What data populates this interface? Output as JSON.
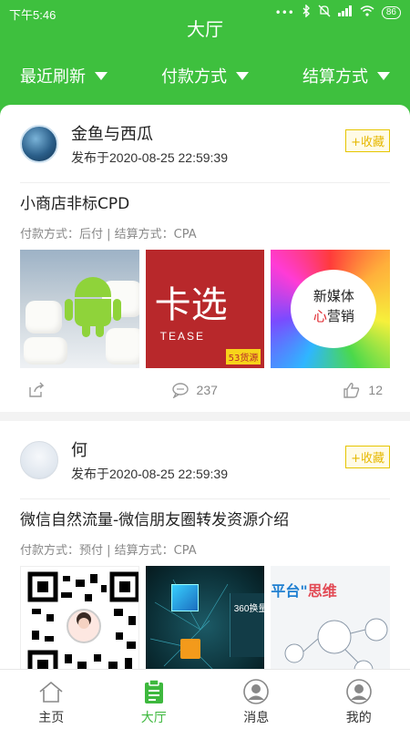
{
  "status_bar": {
    "time": "下午5:46",
    "battery": "86"
  },
  "header": {
    "title": "大厅"
  },
  "filters": [
    {
      "label": "最近刷新"
    },
    {
      "label": "付款方式"
    },
    {
      "label": "结算方式"
    }
  ],
  "posts": [
    {
      "user": "金鱼与西瓜",
      "date": "发布于2020-08-25 22:59:39",
      "favorite_label": "+收藏",
      "title": "小商店非标CPD",
      "meta": "付款方式：后付 | 结算方式：CPA",
      "thumb_texts": {
        "red_big": "卡选",
        "red_tease": "TEASE",
        "red_badge": "53货源",
        "media_line1": "新媒体",
        "media_line2_red": "心",
        "media_line2": "营销"
      },
      "stats": {
        "comments": "237",
        "likes": "12"
      }
    },
    {
      "user": "何",
      "date": "发布于2020-08-25 22:59:39",
      "favorite_label": "+收藏",
      "title": "微信自然流量-微信朋友圈转发资源介绍",
      "meta": "付款方式：预付 | 结算方式：CPA",
      "thumb_texts": {
        "data_panel": "360换量",
        "plat_title_a": "平台\"",
        "plat_title_b": "思维"
      }
    }
  ],
  "bottom_nav": [
    {
      "label": "主页",
      "icon": "home-icon"
    },
    {
      "label": "大厅",
      "icon": "clipboard-icon",
      "active": true
    },
    {
      "label": "消息",
      "icon": "user-icon"
    },
    {
      "label": "我的",
      "icon": "user-icon"
    }
  ],
  "colors": {
    "brand_green": "#3ec03e",
    "favorite_yellow": "#e6c500"
  }
}
